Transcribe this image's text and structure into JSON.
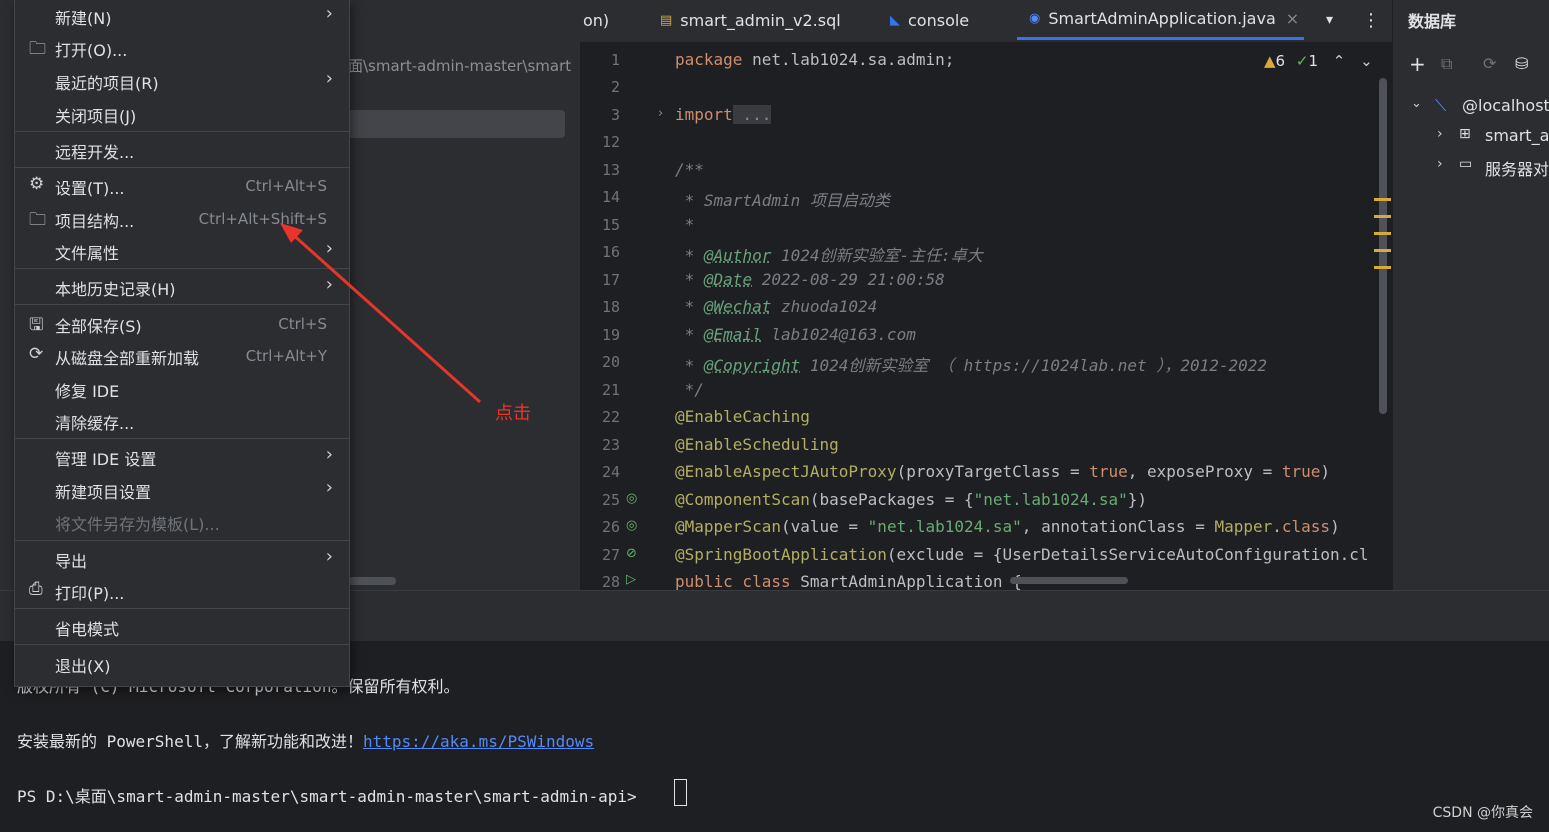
{
  "project": {
    "path": "面\\smart-admin-master\\smart"
  },
  "tabs": [
    {
      "label": "on)",
      "icon": ""
    },
    {
      "label": "smart_admin_v2.sql",
      "icon": "sql-file-icon"
    },
    {
      "label": "console",
      "icon": "console-icon"
    },
    {
      "label": "SmartAdminApplication.java",
      "icon": "java-class-icon",
      "close": "×"
    }
  ],
  "editor": {
    "inspection": {
      "warnings": "6",
      "checks": "1"
    },
    "line_numbers": [
      "1",
      "2",
      "3",
      "12",
      "13",
      "14",
      "15",
      "16",
      "17",
      "18",
      "19",
      "20",
      "21",
      "22",
      "23",
      "24",
      "25",
      "26",
      "27",
      "28"
    ],
    "lines": {
      "l1_kw": "package",
      "l1_rest": " net.lab1024.sa.admin;",
      "l3_kw": "import",
      "l3_fold": " ...",
      "l13": "/**",
      "l14": " * SmartAdmin 项目启动类",
      "l15": " *",
      "l16_pre": " * ",
      "l16_tag": "@Author",
      "l16_rest": " 1024创新实验室-主任:卓大",
      "l17_pre": " * ",
      "l17_tag": "@Date",
      "l17_rest": " 2022-08-29 21:00:58",
      "l18_pre": " * ",
      "l18_tag": "@Wechat",
      "l18_rest": " zhuoda1024",
      "l19_pre": " * ",
      "l19_tag": "@Email",
      "l19_rest": " lab1024@163.com",
      "l20_pre": " * ",
      "l20_tag": "@Copyright",
      "l20_rest": " 1024创新实验室 （ https://1024lab.net ），2012-2022",
      "l21": " */",
      "l22": "@EnableCaching",
      "l23": "@EnableScheduling",
      "l24_ann": "@EnableAspectJAutoProxy",
      "l24_a": "(proxyTargetClass = ",
      "l24_t1": "true",
      "l24_b": ", exposeProxy = ",
      "l24_t2": "true",
      "l24_c": ")",
      "l25_ann": "@ComponentScan",
      "l25_a": "(basePackages = {",
      "l25_s": "\"net.lab1024.sa\"",
      "l25_b": "})",
      "l26_ann": "@MapperScan",
      "l26_a": "(value = ",
      "l26_s": "\"net.lab1024.sa\"",
      "l26_b": ", annotationClass = ",
      "l26_c": "Mapper",
      "l26_d": ".",
      "l26_e": "class",
      "l26_f": ")",
      "l27_ann": "@SpringBootApplication",
      "l27_a": "(exclude = {UserDetailsServiceAutoConfiguration.cl",
      "l28_kw": "public class",
      "l28_rest": " SmartAdminApplication {"
    }
  },
  "database": {
    "title": "数据库",
    "tree": [
      {
        "label": "@localhost",
        "icon": "mysql-icon"
      },
      {
        "label": "smart_ac",
        "icon": "schema-icon"
      },
      {
        "label": "服务器对",
        "icon": "folder-icon"
      }
    ]
  },
  "menu": {
    "items": [
      {
        "label": "新建(N)",
        "arrow": "›"
      },
      {
        "label": "打开(O)...",
        "icon": "folder-icon"
      },
      {
        "label": "最近的项目(R)",
        "arrow": "›"
      },
      {
        "label": "关闭项目(J)"
      },
      {
        "label": "远程开发..."
      },
      {
        "label": "设置(T)...",
        "icon": "gear-icon",
        "shortcut": "Ctrl+Alt+S"
      },
      {
        "label": "项目结构...",
        "icon": "project-structure-icon",
        "shortcut": "Ctrl+Alt+Shift+S"
      },
      {
        "label": "文件属性",
        "arrow": "›"
      },
      {
        "label": "本地历史记录(H)",
        "arrow": "›"
      },
      {
        "label": "全部保存(S)",
        "icon": "save-icon",
        "shortcut": "Ctrl+S"
      },
      {
        "label": "从磁盘全部重新加载",
        "icon": "reload-icon",
        "shortcut": "Ctrl+Alt+Y"
      },
      {
        "label": "修复 IDE"
      },
      {
        "label": "清除缓存..."
      },
      {
        "label": "管理 IDE 设置",
        "arrow": "›"
      },
      {
        "label": "新建项目设置",
        "arrow": "›"
      },
      {
        "label": "将文件另存为模板(L)...",
        "disabled": true
      },
      {
        "label": "导出",
        "arrow": "›"
      },
      {
        "label": "打印(P)...",
        "icon": "print-icon"
      },
      {
        "label": "省电模式"
      },
      {
        "label": "退出(X)"
      }
    ]
  },
  "annotation": {
    "label": "点击",
    "color": "#e8352a"
  },
  "terminal": {
    "line1": "版权所有 (C) Microsoft Corporation。保留所有权利。",
    "line2_pre": "安装最新的 PowerShell，了解新功能和改进！",
    "line2_link": "https://aka.ms/PSWindows",
    "prompt": "PS D:\\桌面\\smart-admin-master\\smart-admin-master\\smart-admin-api> "
  },
  "watermark": "CSDN @你真会"
}
